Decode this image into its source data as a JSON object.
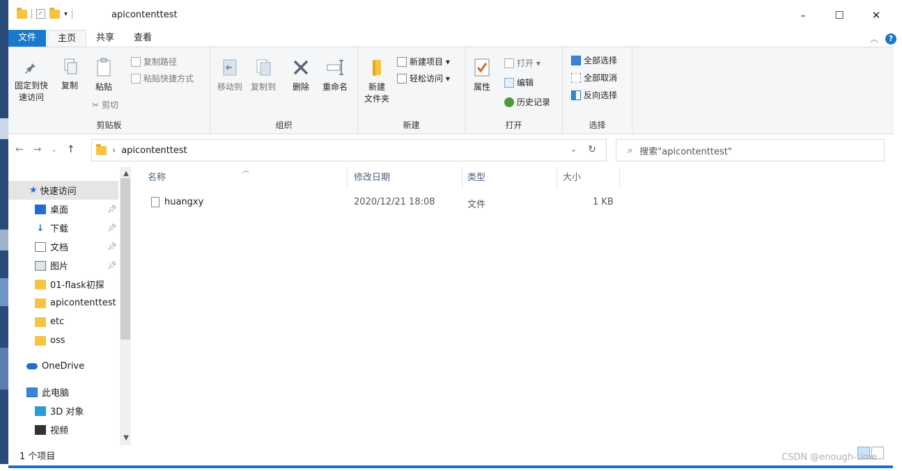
{
  "window": {
    "title": "apicontenttest",
    "controls": {
      "minimize": "–",
      "maximize": "☐",
      "close": "✕"
    }
  },
  "tabs": [
    {
      "label": "文件"
    },
    {
      "label": "主页"
    },
    {
      "label": "共享"
    },
    {
      "label": "查看"
    }
  ],
  "ribbon": {
    "clipboard": {
      "group_label": "剪贴板",
      "pin_line1": "固定到快",
      "pin_line2": "速访问",
      "copy": "复制",
      "paste": "粘贴",
      "copy_path": "复制路径",
      "paste_shortcut": "粘贴快捷方式",
      "cut": "剪切"
    },
    "organize": {
      "group_label": "组织",
      "move_to": "移动到",
      "copy_to": "复制到",
      "delete": "删除",
      "rename": "重命名"
    },
    "new": {
      "group_label": "新建",
      "new_folder_line1": "新建",
      "new_folder_line2": "文件夹",
      "new_item": "新建项目 ▾",
      "easy_access": "轻松访问 ▾"
    },
    "open": {
      "group_label": "打开",
      "properties": "属性",
      "open": "打开 ▾",
      "edit": "编辑",
      "history": "历史记录"
    },
    "select": {
      "group_label": "选择",
      "select_all": "全部选择",
      "select_none": "全部取消",
      "invert": "反向选择"
    }
  },
  "address": {
    "path": "apicontenttest",
    "search_placeholder": "搜索\"apicontenttest\""
  },
  "nav": {
    "quick_access": "快速访问",
    "items": [
      {
        "label": "桌面"
      },
      {
        "label": "下载"
      },
      {
        "label": "文档"
      },
      {
        "label": "图片"
      },
      {
        "label": "01-flask初探"
      },
      {
        "label": "apicontenttest"
      },
      {
        "label": "etc"
      },
      {
        "label": "oss"
      }
    ],
    "onedrive": "OneDrive",
    "this_pc": "此电脑",
    "objects3d": "3D 对象",
    "videos": "视频"
  },
  "columns": {
    "name": "名称",
    "modified": "修改日期",
    "type": "类型",
    "size": "大小"
  },
  "files": [
    {
      "name": "huangxy",
      "modified": "2020/12/21 18:08",
      "type": "文件",
      "size": "1 KB"
    }
  ],
  "status": {
    "count": "1 个项目"
  },
  "watermark": "CSDN @enough-time",
  "colors": {
    "file_tab": "#1979ca",
    "folder": "#f5c542",
    "accent": "#1f6fd1"
  }
}
